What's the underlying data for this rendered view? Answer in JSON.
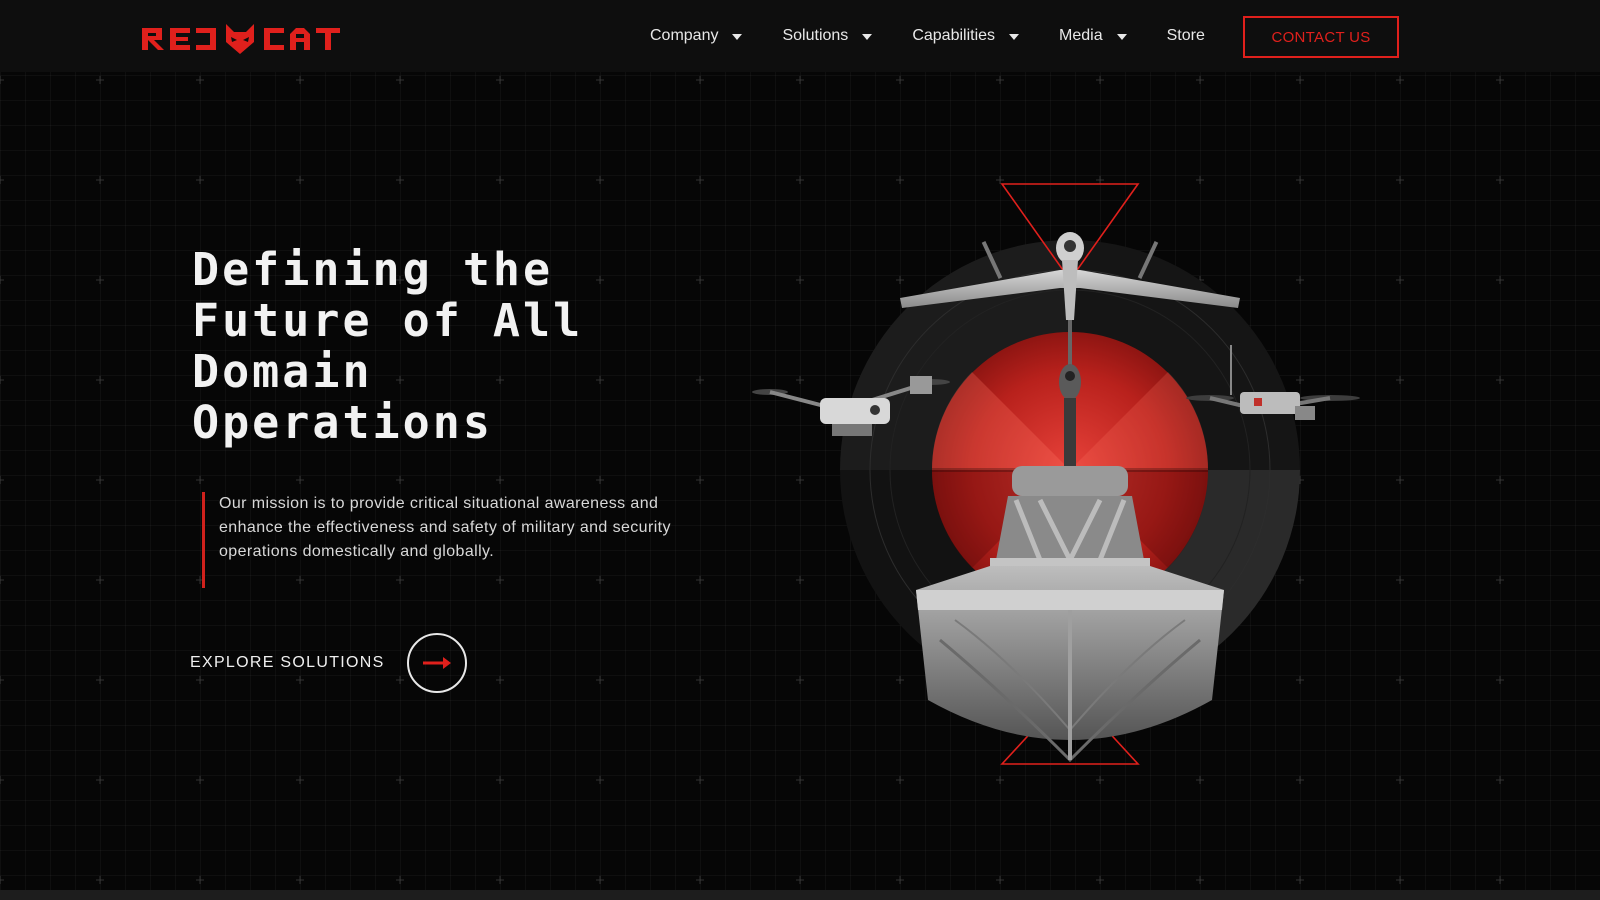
{
  "brand": {
    "logo_text": "RED CAT",
    "accent_color": "#e0201c"
  },
  "nav": {
    "items": [
      {
        "label": "Company",
        "has_dropdown": true
      },
      {
        "label": "Solutions",
        "has_dropdown": true
      },
      {
        "label": "Capabilities",
        "has_dropdown": true
      },
      {
        "label": "Media",
        "has_dropdown": true
      },
      {
        "label": "Store",
        "has_dropdown": false
      }
    ],
    "contact_label": "CONTACT US"
  },
  "hero": {
    "title_lines": [
      "Defining the",
      "Future of All",
      "Domain",
      "Operations"
    ],
    "mission": "Our mission is to provide critical situational awareness and enhance the effectiveness and safety of military and security operations domestically and globally.",
    "cta_label": "EXPLORE SOLUTIONS",
    "cta_icon": "arrow-right-icon"
  },
  "graphic": {
    "icons": [
      "fixed-wing-drone-icon",
      "quadcopter-drone-icon",
      "fpv-drone-icon",
      "unmanned-boat-icon"
    ]
  }
}
